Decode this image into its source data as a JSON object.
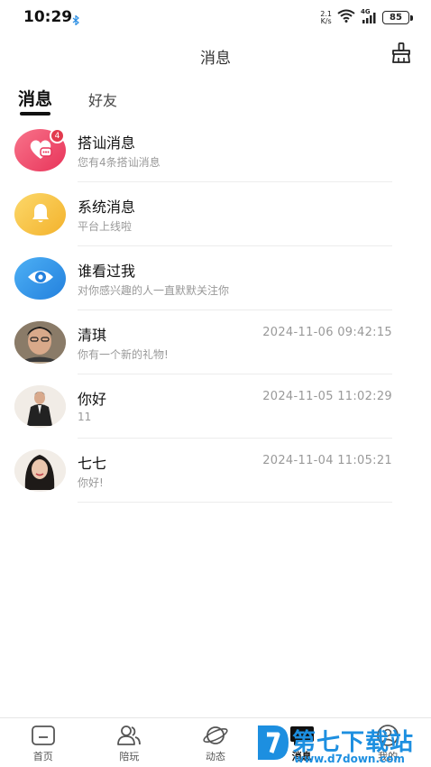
{
  "status_bar": {
    "time": "10:29",
    "net_speed_value": "2.1",
    "net_speed_unit": "K/s",
    "signal_label": "4G",
    "battery": "85"
  },
  "header": {
    "title": "消息",
    "clean_icon": "broom-icon"
  },
  "tabs": [
    {
      "label": "消息",
      "active": true
    },
    {
      "label": "好友",
      "active": false
    }
  ],
  "messages": [
    {
      "name": "搭讪消息",
      "preview": "您有4条搭讪消息",
      "time": "",
      "badge": "4",
      "avatar": "heart-chat-icon"
    },
    {
      "name": "系统消息",
      "preview": "平台上线啦",
      "time": "",
      "badge": "",
      "avatar": "bell-icon"
    },
    {
      "name": "谁看过我",
      "preview": "对你感兴趣的人一直默默关注你",
      "time": "",
      "badge": "",
      "avatar": "eye-icon"
    },
    {
      "name": "清琪",
      "preview": "你有一个新的礼物!",
      "time": "2024-11-06 09:42:15",
      "badge": "",
      "avatar": "user-photo"
    },
    {
      "name": "你好",
      "preview": "11",
      "time": "2024-11-05 11:02:29",
      "badge": "",
      "avatar": "user-photo"
    },
    {
      "name": "七七",
      "preview": "你好!",
      "time": "2024-11-04 11:05:21",
      "badge": "",
      "avatar": "user-photo"
    }
  ],
  "bottom_nav": [
    {
      "label": "首页",
      "icon": "home-icon",
      "active": false
    },
    {
      "label": "陪玩",
      "icon": "users-icon",
      "active": false
    },
    {
      "label": "动态",
      "icon": "planet-icon",
      "active": false
    },
    {
      "label": "消息",
      "icon": "chat-icon",
      "active": true
    },
    {
      "label": "我的",
      "icon": "profile-icon",
      "active": false
    }
  ],
  "watermark": {
    "text": "第七下载站",
    "url": "www.d7down.com"
  },
  "colors": {
    "badge": "#e23a4e",
    "accent_pink": "#ee4f6c",
    "accent_yellow": "#f7c443",
    "accent_blue": "#2d8fe3",
    "watermark_blue": "#1d8fe0"
  }
}
